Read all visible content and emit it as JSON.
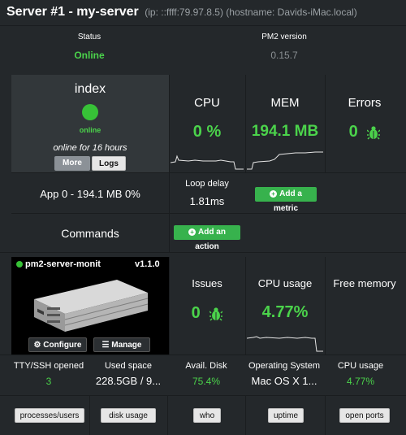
{
  "header": {
    "title": "Server #1 - my-server",
    "meta": "(ip: ::ffff:79.97.8.5) (hostname: Davids-iMac.local)"
  },
  "summary": {
    "status_label": "Status",
    "status_value": "Online",
    "pm2_label": "PM2 version",
    "pm2_value": "0.15.7"
  },
  "process": {
    "name": "index",
    "state": "online",
    "uptime": "online for 16 hours",
    "more_label": "More",
    "logs_label": "Logs",
    "app_line": "App 0 - 194.1 MB 0%",
    "commands_label": "Commands"
  },
  "metrics": {
    "cpu_label": "CPU",
    "cpu_value": "0 %",
    "mem_label": "MEM",
    "mem_value": "194.1 MB",
    "errors_label": "Errors",
    "errors_value": "0",
    "loop_label": "Loop delay",
    "loop_value": "1.81ms",
    "add_metric_label": "Add a metric",
    "add_action_label": "Add an action"
  },
  "module": {
    "name": "pm2-server-monit",
    "version": "v1.1.0",
    "configure_label": "Configure",
    "manage_label": "Manage",
    "issues_label": "Issues",
    "issues_value": "0",
    "cpu_usage_label": "CPU usage",
    "cpu_usage_value": "4.77%",
    "free_memory_label": "Free memory"
  },
  "stats": [
    {
      "label": "TTY/SSH opened",
      "value": "3",
      "color": "green"
    },
    {
      "label": "Used space",
      "value": "228.5GB / 9...",
      "color": "white"
    },
    {
      "label": "Avail. Disk",
      "value": "75.4%",
      "color": "green"
    },
    {
      "label": "Operating System",
      "value": "Mac OS X 1...",
      "color": "white"
    },
    {
      "label": "CPU usage",
      "value": "4.77%",
      "color": "green"
    }
  ],
  "actions": [
    "processes/users",
    "disk usage",
    "who",
    "uptime",
    "open ports"
  ],
  "colors": {
    "accent_green": "#4bd34b",
    "button_green": "#37b24d",
    "background": "#24282b"
  }
}
